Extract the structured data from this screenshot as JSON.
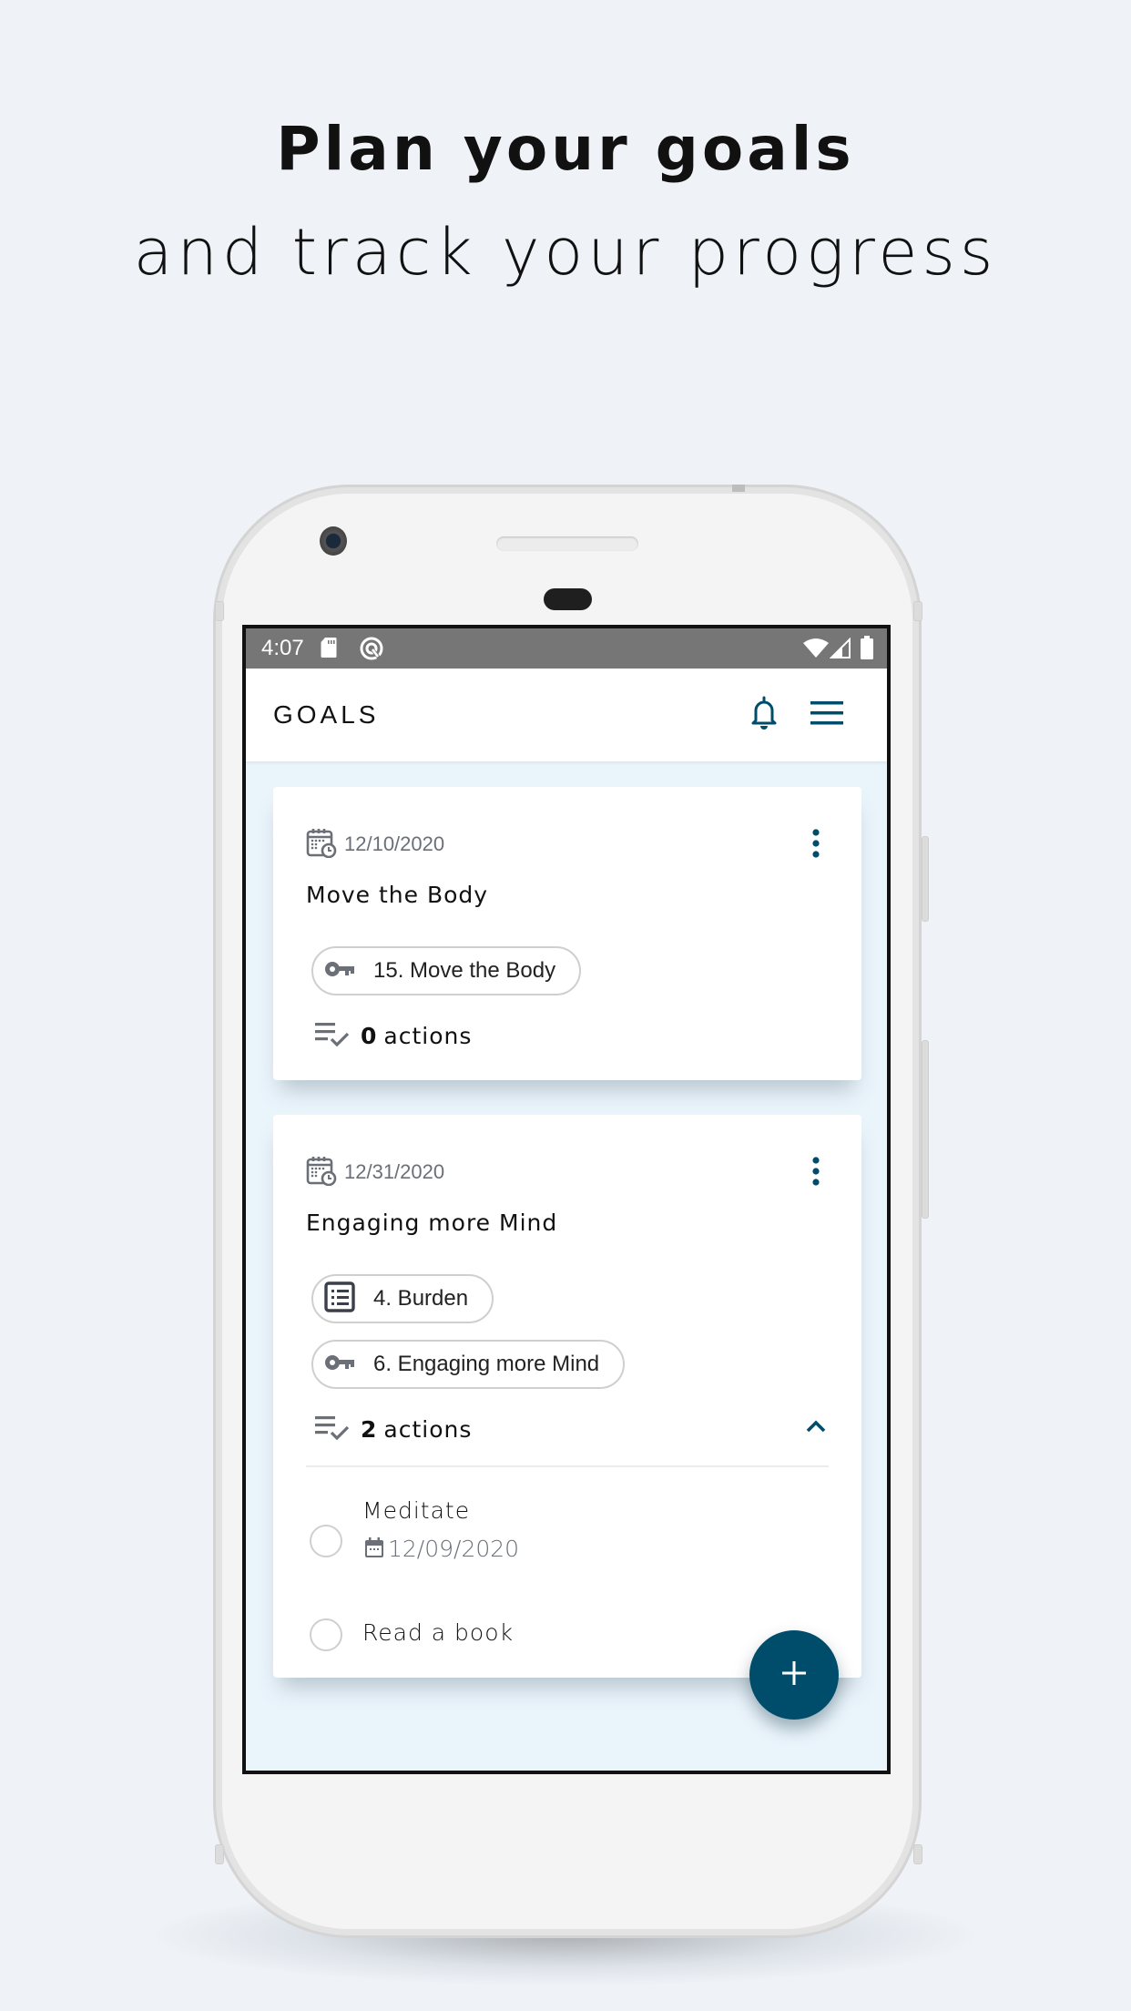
{
  "headline": {
    "line1": "Plan your goals",
    "line2": "and track your progress"
  },
  "status_bar": {
    "time": "4:07",
    "icons": [
      "sd-card-icon",
      "app-notification-icon",
      "wifi-icon",
      "cellular-signal-icon",
      "battery-icon"
    ]
  },
  "app_bar": {
    "title": "GOALS",
    "icons": [
      "bell-icon",
      "hamburger-menu-icon"
    ]
  },
  "colors": {
    "accent": "#004d6b",
    "icon_gray": "#6a6f78",
    "content_bg": "#eaf4fb",
    "status_bar": "#767676",
    "page_bg": "#eff3f8"
  },
  "goals": [
    {
      "date": "12/10/2020",
      "title": "Move the Body",
      "chips": [
        {
          "icon": "key-icon",
          "label": "15. Move the Body"
        }
      ],
      "actions_count": "0",
      "actions_label": "actions",
      "expanded": false,
      "actions": []
    },
    {
      "date": "12/31/2020",
      "title": "Engaging more Mind",
      "chips": [
        {
          "icon": "list-icon",
          "label": "4. Burden"
        },
        {
          "icon": "key-icon",
          "label": "6. Engaging more Mind"
        }
      ],
      "actions_count": "2",
      "actions_label": "actions",
      "expanded": true,
      "actions": [
        {
          "title": "Meditate",
          "date": "12/09/2020",
          "done": false
        },
        {
          "title": "Read a book",
          "done": false
        }
      ]
    }
  ],
  "fab": {
    "icon": "plus-icon"
  }
}
